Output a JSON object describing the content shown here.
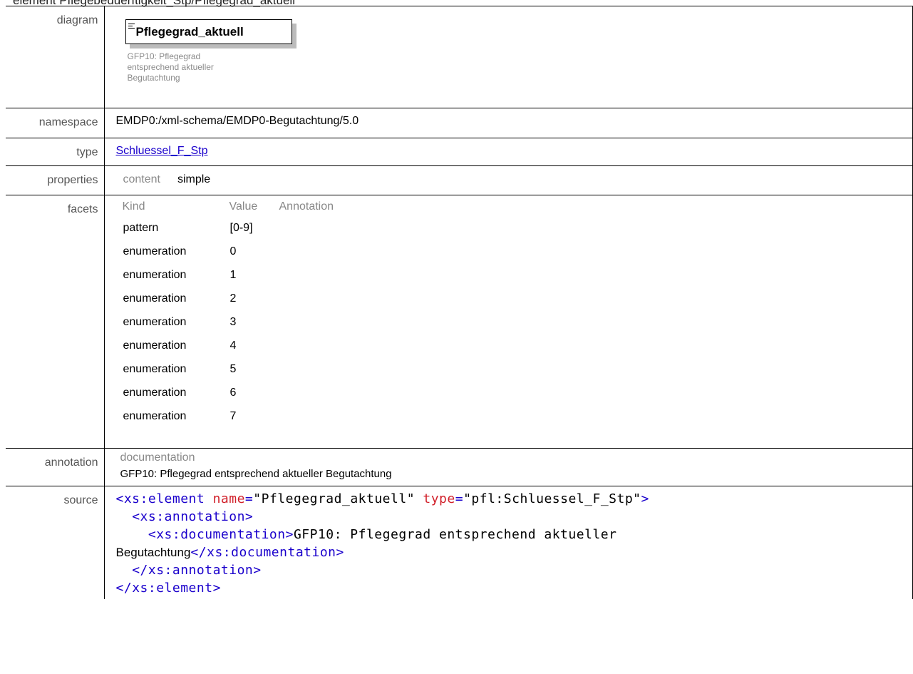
{
  "header": {
    "title": "element Pflegebeduerftigkeit_Stp/Pflegegrad_aktuell"
  },
  "labels": {
    "diagram": "diagram",
    "namespace": "namespace",
    "type": "type",
    "properties": "properties",
    "facets": "facets",
    "annotation": "annotation",
    "source": "source"
  },
  "diagram": {
    "element_name": "Pflegegrad_aktuell",
    "doc_lines": [
      "GFP10: Pflegegrad",
      "entsprechend aktueller",
      "Begutachtung"
    ]
  },
  "namespace": {
    "value": "EMDP0:/xml-schema/EMDP0-Begutachtung/5.0"
  },
  "type": {
    "link_text": "Schluessel_F_Stp"
  },
  "properties": {
    "key": "content",
    "value": "simple"
  },
  "facets": {
    "headers": [
      "Kind",
      "Value",
      "Annotation"
    ],
    "rows": [
      {
        "kind": "pattern",
        "value": "[0-9]"
      },
      {
        "kind": "enumeration",
        "value": "0"
      },
      {
        "kind": "enumeration",
        "value": "1"
      },
      {
        "kind": "enumeration",
        "value": "2"
      },
      {
        "kind": "enumeration",
        "value": "3"
      },
      {
        "kind": "enumeration",
        "value": "4"
      },
      {
        "kind": "enumeration",
        "value": "5"
      },
      {
        "kind": "enumeration",
        "value": "6"
      },
      {
        "kind": "enumeration",
        "value": "7"
      }
    ]
  },
  "annotation": {
    "title": "documentation",
    "text": "GFP10: Pflegegrad entsprechend aktueller Begutachtung"
  },
  "source": {
    "open_tag": "xs:element",
    "attr_name": "name",
    "attr_name_value": "Pflegegrad_aktuell",
    "attr_type": "type",
    "attr_type_value": "pfl:Schluessel_F_Stp",
    "annotation_tag": "xs:annotation",
    "documentation_tag": "xs:documentation",
    "documentation_text_1": "GFP10: Pflegegrad entsprechend aktueller",
    "documentation_text_2": "Begutachtung"
  },
  "colors": {
    "link": "#1a00cc",
    "tag": "#1a00cc",
    "attribute": "#d1202a",
    "label": "#555555"
  }
}
